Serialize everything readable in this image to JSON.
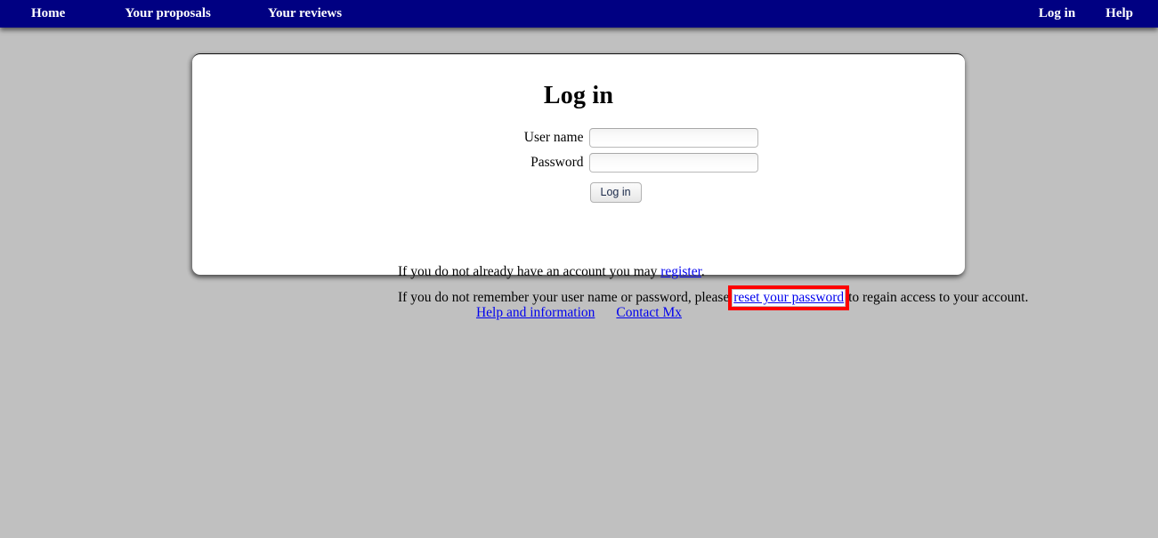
{
  "navbar": {
    "background_color": "#000082",
    "text_color": "#ffffff",
    "left_items": [
      {
        "label": "Home",
        "name": "nav-item-home"
      },
      {
        "label": "Your proposals",
        "name": "nav-item-your-proposals"
      },
      {
        "label": "Your reviews",
        "name": "nav-item-your-reviews"
      }
    ],
    "right_items": [
      {
        "label": "Log in",
        "name": "nav-item-log-in"
      },
      {
        "label": "Help",
        "name": "nav-item-help"
      }
    ]
  },
  "card": {
    "title": "Log in",
    "form": {
      "username": {
        "label": "User name",
        "value": "",
        "placeholder": ""
      },
      "password": {
        "label": "Password",
        "value": "",
        "placeholder": ""
      },
      "submit_label": "Log in"
    },
    "register_line": {
      "before": "If you do not already have an account you may ",
      "link": "register",
      "after": "."
    },
    "reset_line": {
      "before": "If you do not remember your user name or password, please ",
      "link": "reset your password",
      "after": " to regain access to your account."
    }
  },
  "footer": {
    "links": [
      {
        "label": "Help and information",
        "name": "footer-link-help-and-information"
      },
      {
        "label": "Contact Mx",
        "name": "footer-link-contact-mx"
      }
    ]
  },
  "annotation": {
    "highlight_color": "#ff0000",
    "highlighted_element": "reset your password"
  },
  "colors": {
    "page_background": "#c0c0c0",
    "card_background": "#ffffff",
    "link": "#0000ee",
    "navbar": "#000082",
    "highlight": "#ff0000"
  }
}
